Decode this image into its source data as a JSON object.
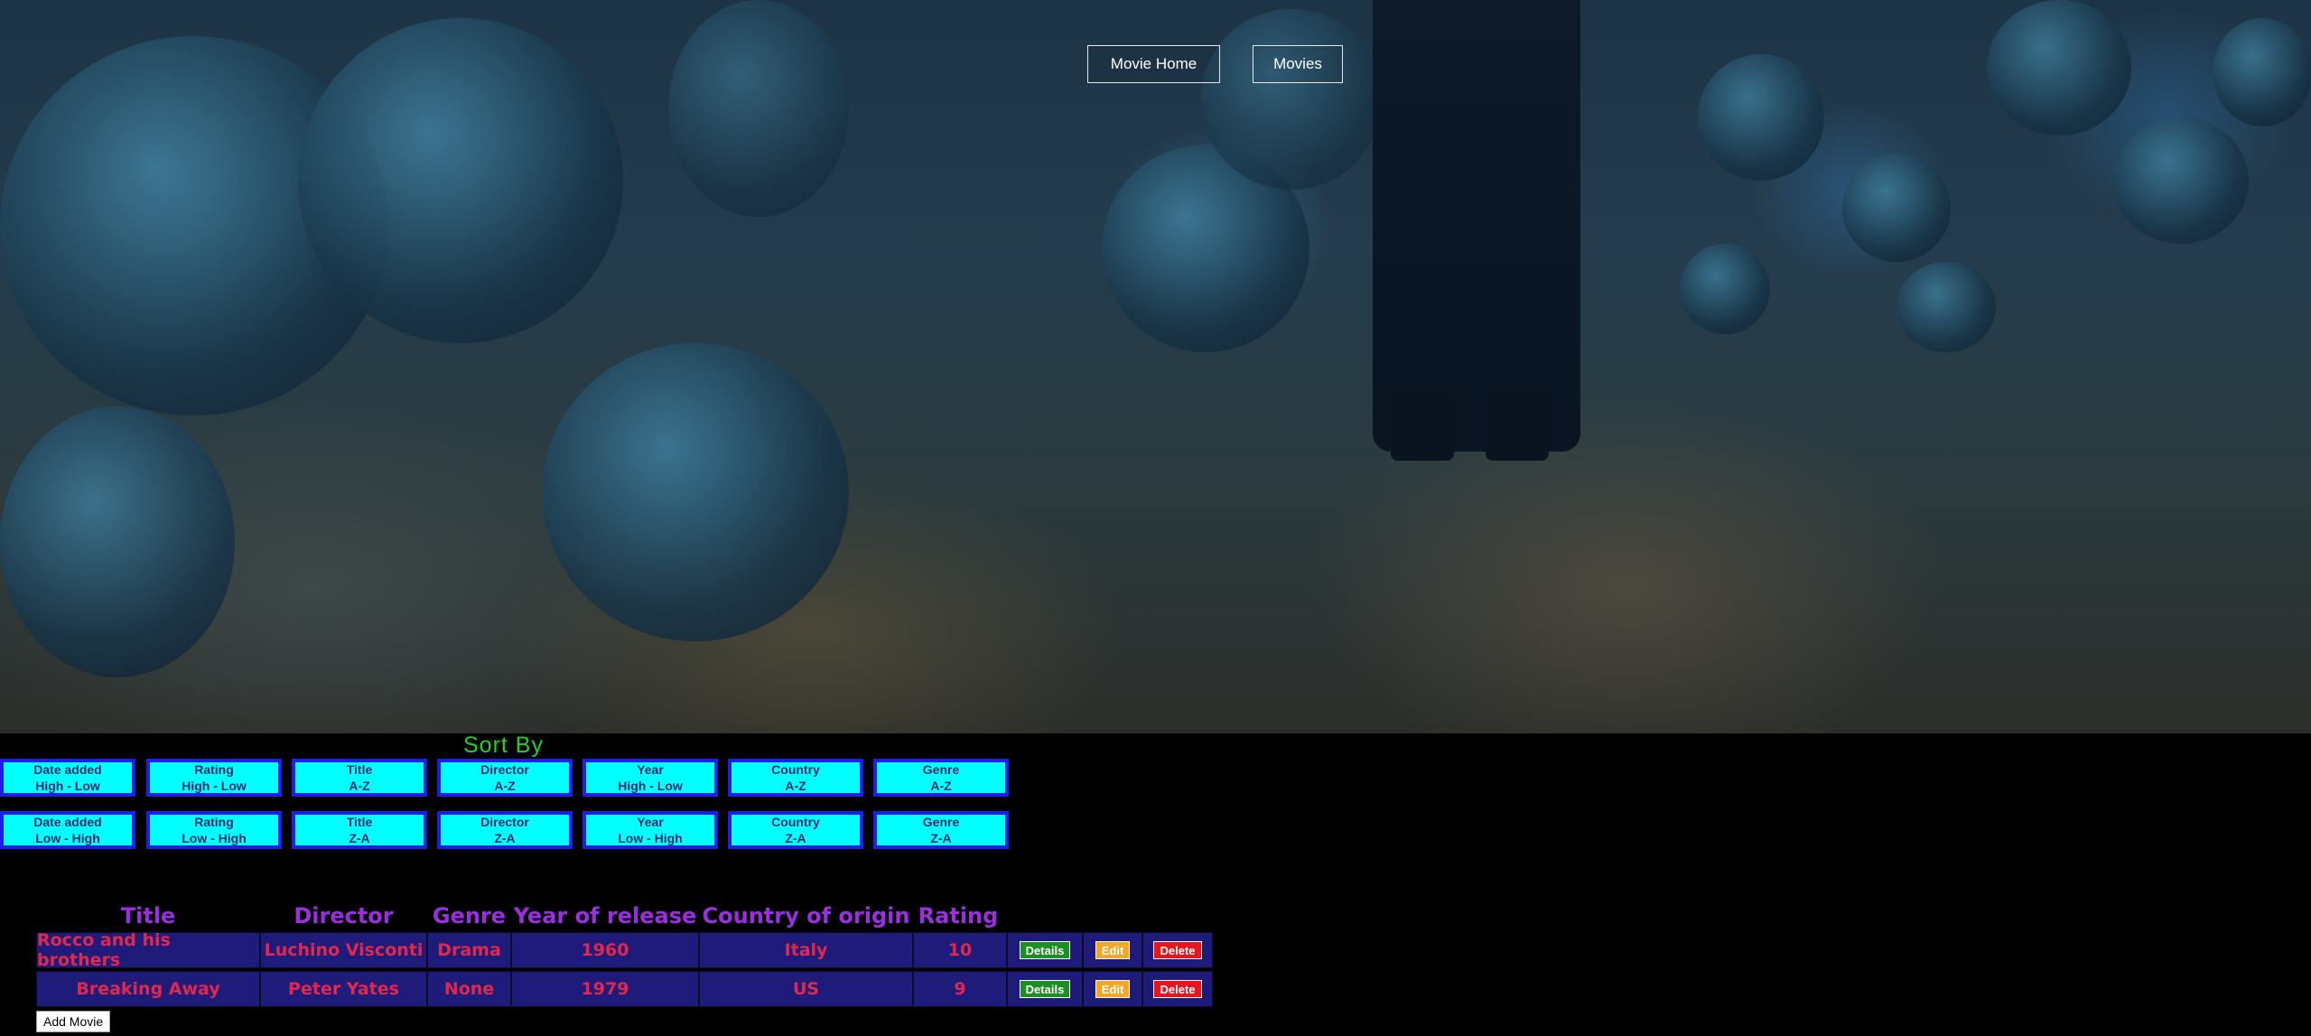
{
  "nav": {
    "movie_home": "Movie Home",
    "movies": "Movies"
  },
  "sort": {
    "title": "Sort By",
    "row1": [
      {
        "line1": "Date added",
        "line2": "High - Low"
      },
      {
        "line1": "Rating",
        "line2": "High - Low"
      },
      {
        "line1": "Title",
        "line2": "A-Z"
      },
      {
        "line1": "Director",
        "line2": "A-Z"
      },
      {
        "line1": "Year",
        "line2": "High - Low"
      },
      {
        "line1": "Country",
        "line2": "A-Z"
      },
      {
        "line1": "Genre",
        "line2": "A-Z"
      }
    ],
    "row2": [
      {
        "line1": "Date added",
        "line2": "Low - High"
      },
      {
        "line1": "Rating",
        "line2": "Low - High"
      },
      {
        "line1": "Title",
        "line2": "Z-A"
      },
      {
        "line1": "Director",
        "line2": "Z-A"
      },
      {
        "line1": "Year",
        "line2": "Low - High"
      },
      {
        "line1": "Country",
        "line2": "Z-A"
      },
      {
        "line1": "Genre",
        "line2": "Z-A"
      }
    ]
  },
  "table": {
    "headers": [
      "Title",
      "Director",
      "Genre",
      "Year of release",
      "Country of origin",
      "Rating"
    ],
    "rows": [
      {
        "title": "Rocco and his brothers",
        "director": "Luchino Visconti",
        "genre": "Drama",
        "year": "1960",
        "country": "Italy",
        "rating": "10"
      },
      {
        "title": "Breaking Away",
        "director": "Peter Yates",
        "genre": "None",
        "year": "1979",
        "country": "US",
        "rating": "9"
      }
    ],
    "actions": {
      "details": "Details",
      "edit": "Edit",
      "delete": "Delete"
    }
  },
  "add_movie": "Add Movie",
  "colors": {
    "sort_bg": "#00ffff",
    "sort_border": "#1a20e6",
    "header_text": "#9a2fe0",
    "cell_bg": "#1f1b7a",
    "cell_text": "#e0284e",
    "details_btn": "#1d8f22",
    "edit_btn": "#f3a723",
    "delete_btn": "#e8141e",
    "sort_title": "#18d61c"
  }
}
